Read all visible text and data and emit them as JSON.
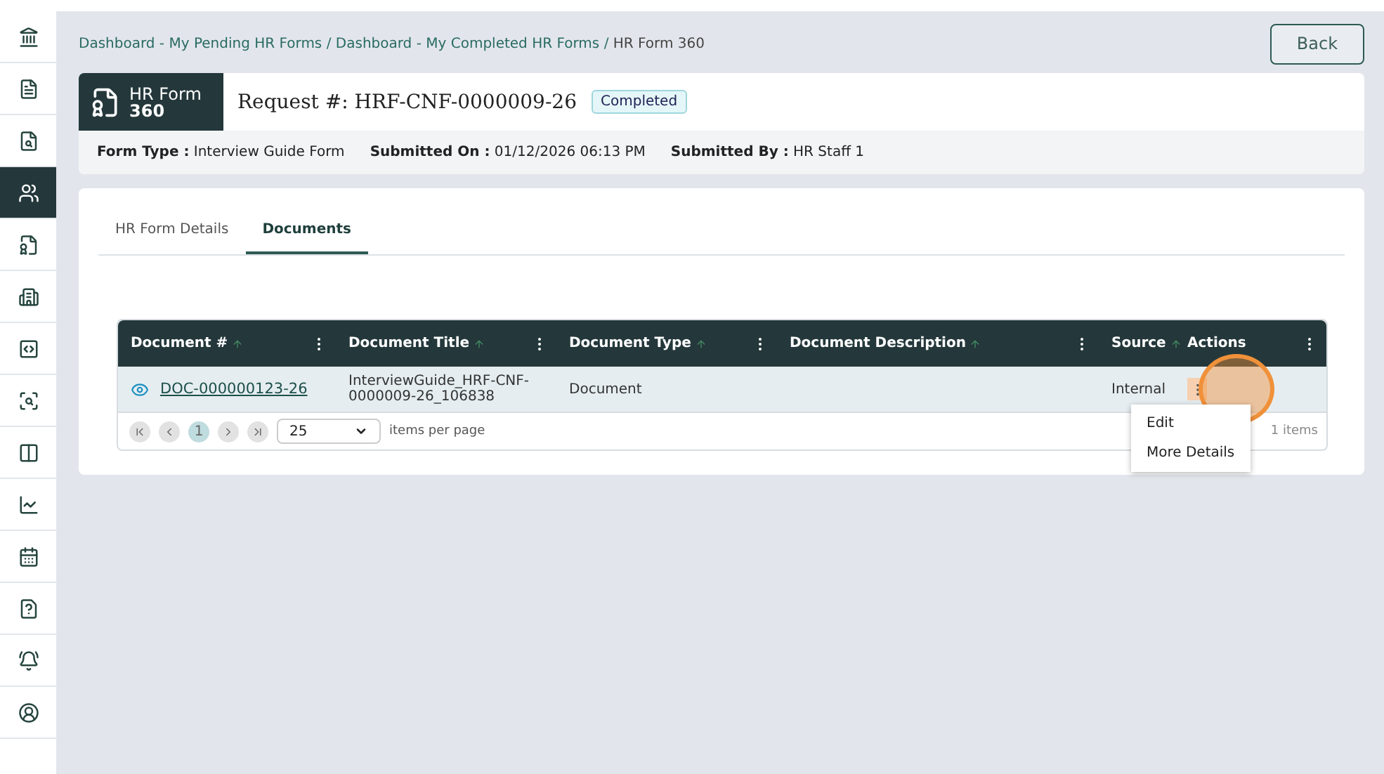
{
  "sidebar": {
    "items": [
      {
        "selected": false
      },
      {
        "selected": false
      },
      {
        "selected": false
      },
      {
        "selected": true
      },
      {
        "selected": false
      },
      {
        "selected": false
      },
      {
        "selected": false
      },
      {
        "selected": false
      },
      {
        "selected": false
      },
      {
        "selected": false
      },
      {
        "selected": false
      },
      {
        "selected": false
      },
      {
        "selected": false
      },
      {
        "selected": false
      }
    ]
  },
  "breadcrumb": [
    "Dashboard - My Pending HR Forms",
    "/",
    "Dashboard - My Completed HR Forms",
    "/",
    "HR Form 360"
  ],
  "back_button": "Back",
  "header": {
    "badge_line1": "HR Form",
    "badge_line2": "360",
    "request_label": "Request #: HRF-CNF-0000009-26",
    "status": "Completed",
    "meta": [
      {
        "label": "Form Type :",
        "value": "Interview Guide Form"
      },
      {
        "label": "Submitted On :",
        "value": "01/12/2026 06:13 PM"
      },
      {
        "label": "Submitted By :",
        "value": "HR Staff 1"
      }
    ]
  },
  "tabs": [
    {
      "label": "HR Form Details",
      "selected": false
    },
    {
      "label": "Documents",
      "selected": true
    }
  ],
  "table": {
    "columns": [
      "Document #",
      "Document Title",
      "Document Type",
      "Document Description",
      "Source",
      "Actions"
    ],
    "rows": [
      {
        "document_no": "DOC-000000123-26",
        "title": "InterviewGuide_HRF-CNF-0000009-26_106838",
        "type": "Document",
        "source": "Internal"
      }
    ]
  },
  "pager": {
    "pages": [
      {
        "label": "1",
        "selected": true
      }
    ],
    "page_size": "25",
    "page_size_label": "items per page",
    "info": "1 items"
  },
  "menu": [
    "Edit",
    "More Details"
  ],
  "click_highlight": true
}
